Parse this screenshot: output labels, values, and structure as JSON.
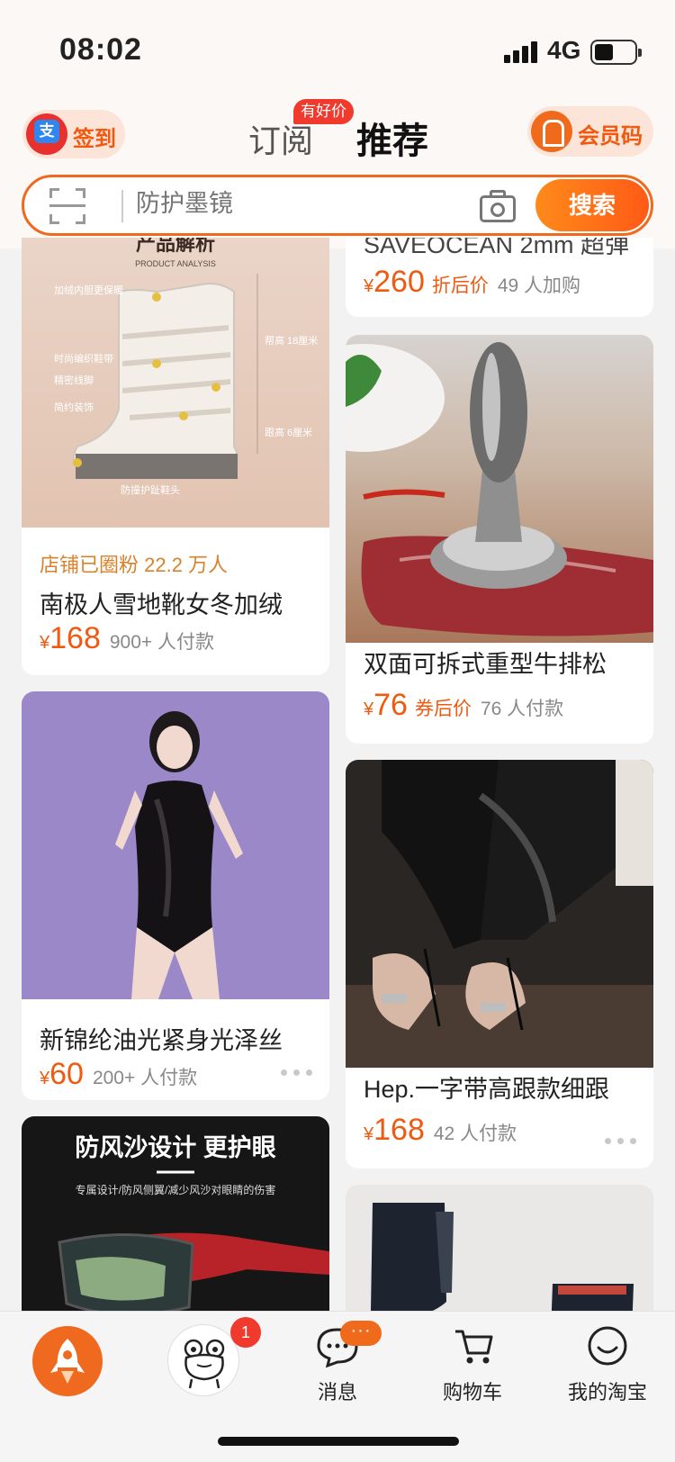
{
  "status": {
    "time": "08:02",
    "network": "4G"
  },
  "header": {
    "checkin_label": "签到",
    "checkin_icon_char": "支",
    "tab_subscribe": "订阅",
    "tab_subscribe_badge": "有好价",
    "tab_recommend": "推荐",
    "member_code": "会员码"
  },
  "search": {
    "placeholder": "防护墨镜",
    "button": "搜索"
  },
  "feed": {
    "left": [
      {
        "image": "boot",
        "image_heading": "产品解析",
        "image_subheading": "PRODUCT ANALYSIS",
        "image_callouts": [
          "加绒内胆更保暖",
          "时尚编织鞋带",
          "精密线脚",
          "简约装饰",
          "防撞护趾鞋头",
          "帮高 18厘米",
          "跟高 6厘米"
        ],
        "fans": "店铺已圈粉 22.2 万人",
        "title": "南极人雪地靴女冬加绒",
        "currency": "¥",
        "price": "168",
        "sold": "900+ 人付款"
      },
      {
        "image": "swimsuit",
        "title": "新锦纶油光紧身光泽丝",
        "currency": "¥",
        "price": "60",
        "sold": "200+ 人付款"
      },
      {
        "image": "goggles",
        "image_heading": "防风沙设计 更护眼",
        "image_subheading": "专属设计/防风侧翼/减少风沙对眼睛的伤害"
      }
    ],
    "right": [
      {
        "title_partial": "SAVEOCEAN 2mm 超弹",
        "currency": "¥",
        "price": "260",
        "tag": "折后价",
        "sold": "49 人加购"
      },
      {
        "image": "meat-tenderizer",
        "title": "双面可拆式重型牛排松",
        "currency": "¥",
        "price": "76",
        "tag": "券后价",
        "sold": "76 人付款"
      },
      {
        "image": "heels",
        "title": "Hep.一字带高跟款细跟",
        "currency": "¥",
        "price": "168",
        "sold": "42 人付款"
      },
      {
        "image": "black-boots"
      }
    ]
  },
  "nav": {
    "message": "消息",
    "message_badge": "···",
    "cart": "购物车",
    "me": "我的淘宝",
    "frog_badge": "1"
  },
  "colors": {
    "accent": "#ef5a10",
    "badge": "#f03a2e"
  }
}
